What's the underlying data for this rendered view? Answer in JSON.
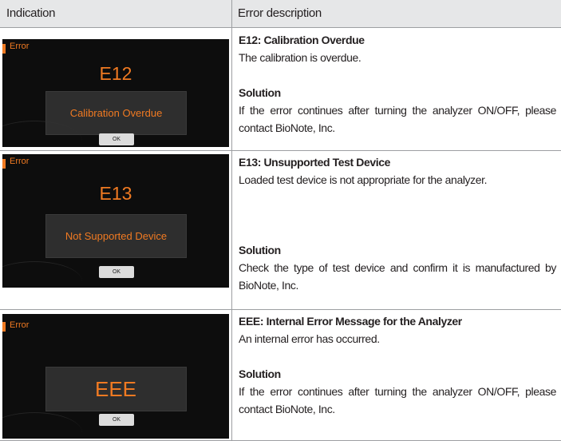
{
  "header": {
    "col1": "Indication",
    "col2": "Error description"
  },
  "rows": [
    {
      "screen": {
        "label": "Error",
        "code": "E12",
        "message": "Calibration Overdue",
        "ok": "OK"
      },
      "title": "E12: Calibration Overdue",
      "description": "The calibration is overdue.",
      "solution_label": "Solution",
      "solution": "If the error continues after turning the analyzer ON/OFF, please contact BioNote, Inc."
    },
    {
      "screen": {
        "label": "Error",
        "code": "E13",
        "message": "Not Supported Device",
        "ok": "OK"
      },
      "title": "E13: Unsupported Test Device",
      "description": "Loaded test device is not appropriate for the analyzer.",
      "solution_label": "Solution",
      "solution": "Check the type of test device and confirm it is manufactured by BioNote, Inc."
    },
    {
      "screen": {
        "label": "Error",
        "code": "EEE",
        "message": "",
        "ok": "OK"
      },
      "title": "EEE: Internal Error Message for the Analyzer",
      "description": "An internal error has occurred.",
      "solution_label": "Solution",
      "solution": "If the error continues after turning the analyzer ON/OFF, please contact BioNote, Inc."
    }
  ]
}
